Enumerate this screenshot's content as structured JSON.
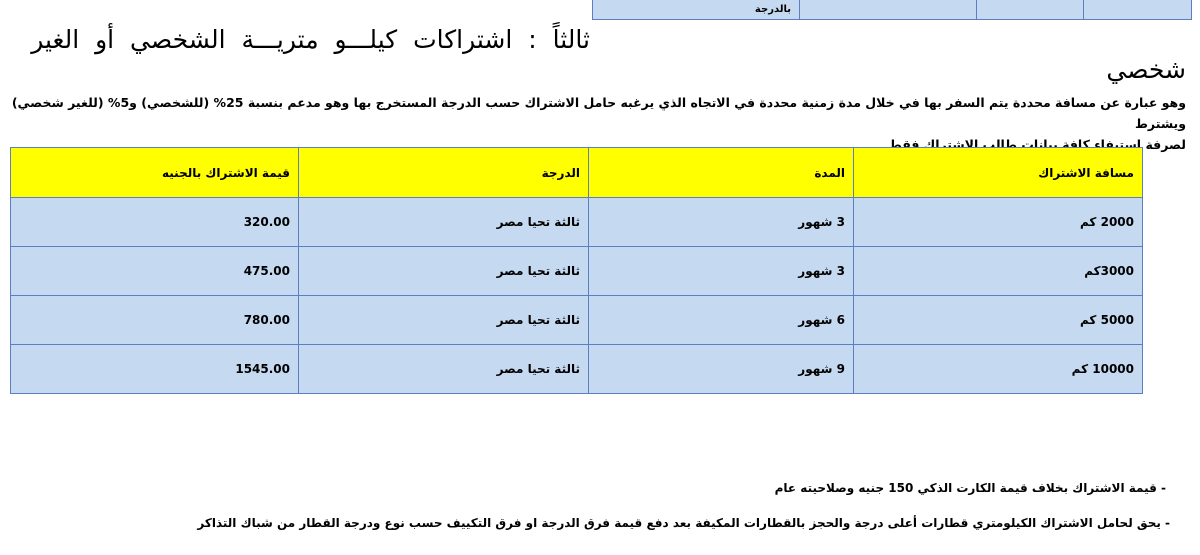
{
  "previous_table": {
    "cell_text": "بالدرجة"
  },
  "heading": {
    "line1": "ثالثاً : اشتراكات كيلـــو متريـــة الشخصي أو الغير",
    "line2": "شخصي"
  },
  "intro": {
    "line1": "وهو عبارة عن مسافة محددة يتم السفر بها في خلال مدة زمنية محددة في الاتجاه الذي يرغبه حامل الاشتراك حسب الدرجة المستخرج بها وهو مدعم بنسبة 25% (للشخصي) و5% (للغير شخصي) ويشترط",
    "line2": "لصرفة استيفاء كافة بيانات طالب الاشتراك فقط"
  },
  "table": {
    "headers": [
      "مسافة الاشتراك",
      "المدة",
      "الدرجة",
      "قيمة الاشتراك بالجنيه"
    ],
    "rows": [
      [
        "2000 كم",
        "3 شهور",
        "ثالثة تحيا مصر",
        "320.00"
      ],
      [
        "3000كم",
        "3 شهور",
        "ثالثة تحيا مصر",
        "475.00"
      ],
      [
        "5000 كم",
        "6 شهور",
        "ثالثة تحيا مصر",
        "780.00"
      ],
      [
        "10000 كم",
        "9 شهور",
        "ثالثة تحيا مصر",
        "1545.00"
      ]
    ]
  },
  "notes": [
    "-   قيمة الاشتراك بخلاف قيمة الكارت الذكي 150 جنيه وصلاحيته عام",
    "- يحق لحامل الاشتراك الكيلومتري قطارات أعلى درجة والحجز بالقطارات المكيفة بعد دفع قيمة فرق الدرجة او فرق التكييف حسب نوع ودرجة القطار من شباك التذاكر"
  ],
  "colors": {
    "header_bg": "#ffff00",
    "cell_bg": "#c5d9f1",
    "border": "#5b7fc1"
  }
}
